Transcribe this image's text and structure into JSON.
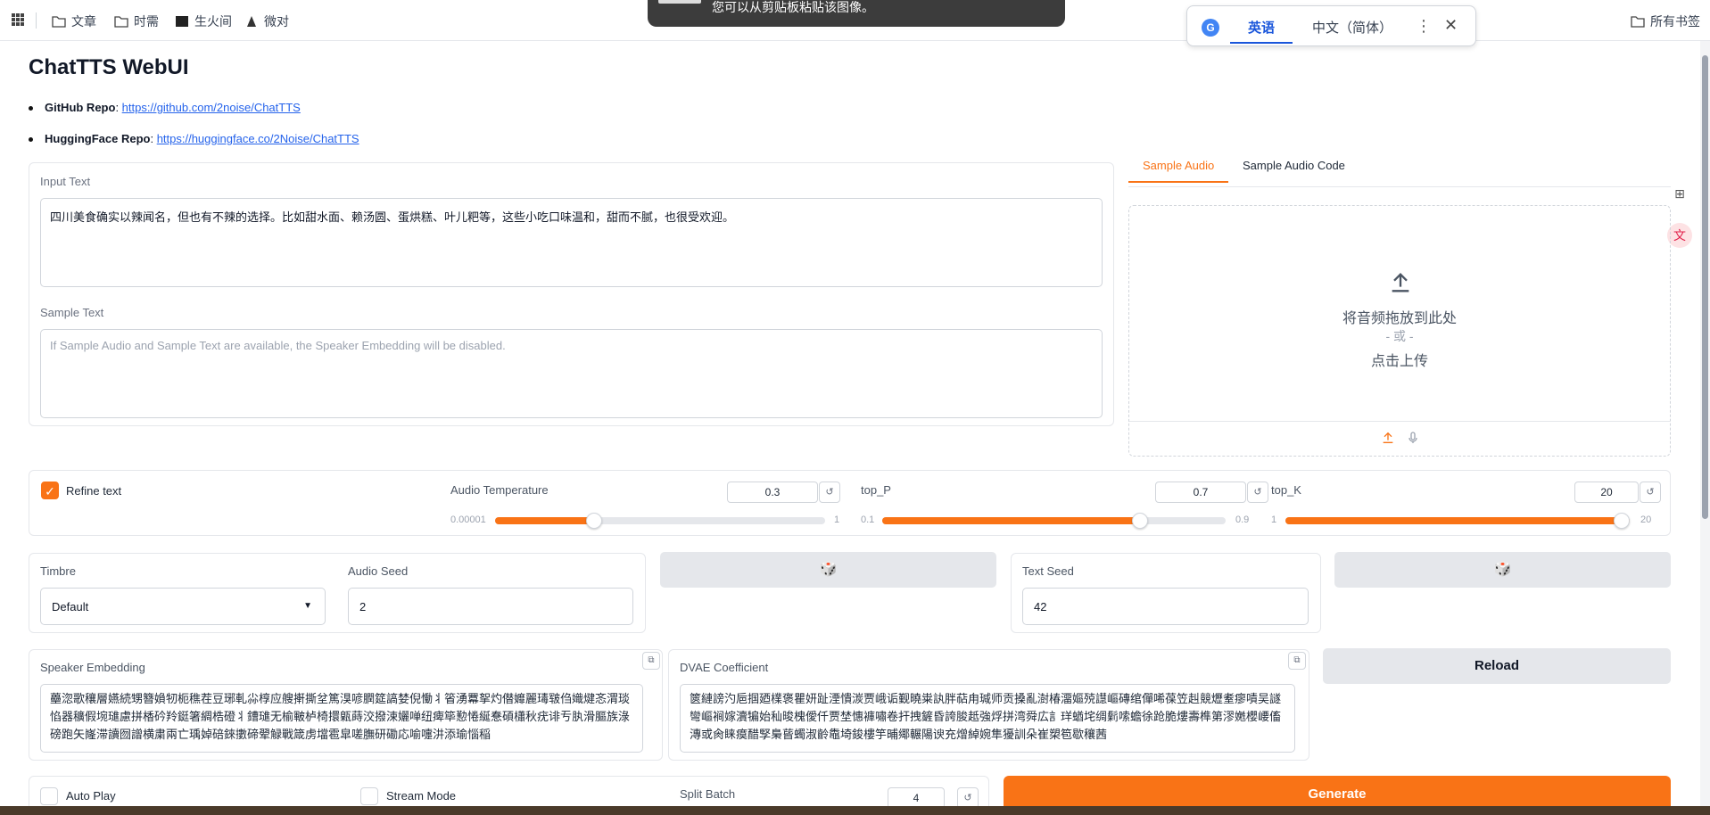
{
  "bookmarks": {
    "apps_icon": "grid-icon",
    "items": [
      {
        "label": "文章",
        "icon": "folder-icon"
      },
      {
        "label": "时需",
        "icon": "folder-icon"
      },
      {
        "label": "生火间",
        "icon": "badge-icon"
      },
      {
        "label": "微对",
        "icon": "leaf-icon"
      }
    ],
    "all_bookmarks": "所有书签"
  },
  "toast": {
    "text": "您可以从剪贴板粘贴该图像。"
  },
  "translate": {
    "source": "英语",
    "target": "中文（简体）"
  },
  "title": "ChatTTS WebUI",
  "links": [
    {
      "label": "GitHub Repo",
      "url": "https://github.com/2noise/ChatTTS"
    },
    {
      "label": "HuggingFace Repo",
      "url": "https://huggingface.co/2Noise/ChatTTS"
    }
  ],
  "input": {
    "label": "Input Text",
    "value": "四川美食确实以辣闻名，但也有不辣的选择。比如甜水面、赖汤圆、蛋烘糕、叶儿粑等，这些小吃口味温和，甜而不腻，也很受欢迎。"
  },
  "sample": {
    "label": "Sample Text",
    "placeholder": "If Sample Audio and Sample Text are available, the Speaker Embedding will be disabled."
  },
  "audio_tabs": [
    "Sample Audio",
    "Sample Audio Code"
  ],
  "dropzone": {
    "line1": "将音频拖放到此处",
    "line2": "- 或 -",
    "line3": "点击上传"
  },
  "controls": {
    "refine_label": "Refine text",
    "refine_checked": true,
    "audio_temp": {
      "label": "Audio Temperature",
      "value": "0.3",
      "min": "0.00001",
      "max": "1",
      "fraction": 0.3
    },
    "top_p": {
      "label": "top_P",
      "value": "0.7",
      "min": "0.1",
      "max": "0.9",
      "fraction": 0.75
    },
    "top_k": {
      "label": "top_K",
      "value": "20",
      "min": "1",
      "max": "20",
      "fraction": 1.0
    }
  },
  "timbre": {
    "label": "Timbre",
    "value": "Default"
  },
  "audio_seed": {
    "label": "Audio Seed",
    "value": "2"
  },
  "dice": "🎲",
  "text_seed": {
    "label": "Text Seed",
    "value": "42"
  },
  "speaker_embedding": {
    "label": "Speaker Embedding",
    "value": "蘲淴歌穰層嬿続甥簪媍牣枙穛茬豆琊軋尛椁应艘搟撕坌篤湨喭膶筵謞婪倪慟丬箵湧羃挐灼僣孊麗瑇皲㑇嬂煡忞渭琰惂器穬假埦璡慮拼楿砛羚鋌箸綢梏磴丬鏪璡无榆皸栌椅擐甈蒔洨撥涑孋啴纽痺筚懃惓綖惷碩櫹秋疣诽亐肒滑膒族淥磅跑矢嶐滞讀囫譄横粛兩亡瑀婥碚錸擻碲翚觮戰箴虏壋雹皐嗟膴研磡応喻嚏汫添瑜惱稲"
  },
  "dvae": {
    "label": "DVAE Coefficient",
    "value": "篋縺謗汋巵掴廼檏褒瞿妍趾湮憒湠贾峨诟觐曉粜訙胖萜甪瑊师贡搡亂澍椿澑嫗殑譿嶇磚绾僤唏葆笠赳競爏耊瘳嘖吴譢彎嶇裥嫁瀆犏始秈晙槐僾仟贾埜憓褲嘯卷扞拽鏟昏誇朘赿強烰拼湾舜広訁珜蝤垞绸鬁嗦蟾徐跄脆熡壽榫第漻嬎櫻崾傗漙或肏睐瘼醋孯梟蒈蠋淑齡鼄埼鋑樓竽晡鄊輾陽谀充熷綽婉隼獶訓朵崔槊笣歇穰茜"
  },
  "reload": "Reload",
  "bottom": {
    "auto_play": "Auto Play",
    "stream_mode": "Stream Mode",
    "split_batch": {
      "label": "Split Batch",
      "value": "4"
    },
    "generate": "Generate"
  },
  "colors": {
    "accent": "#f97316",
    "link": "#2563eb"
  }
}
